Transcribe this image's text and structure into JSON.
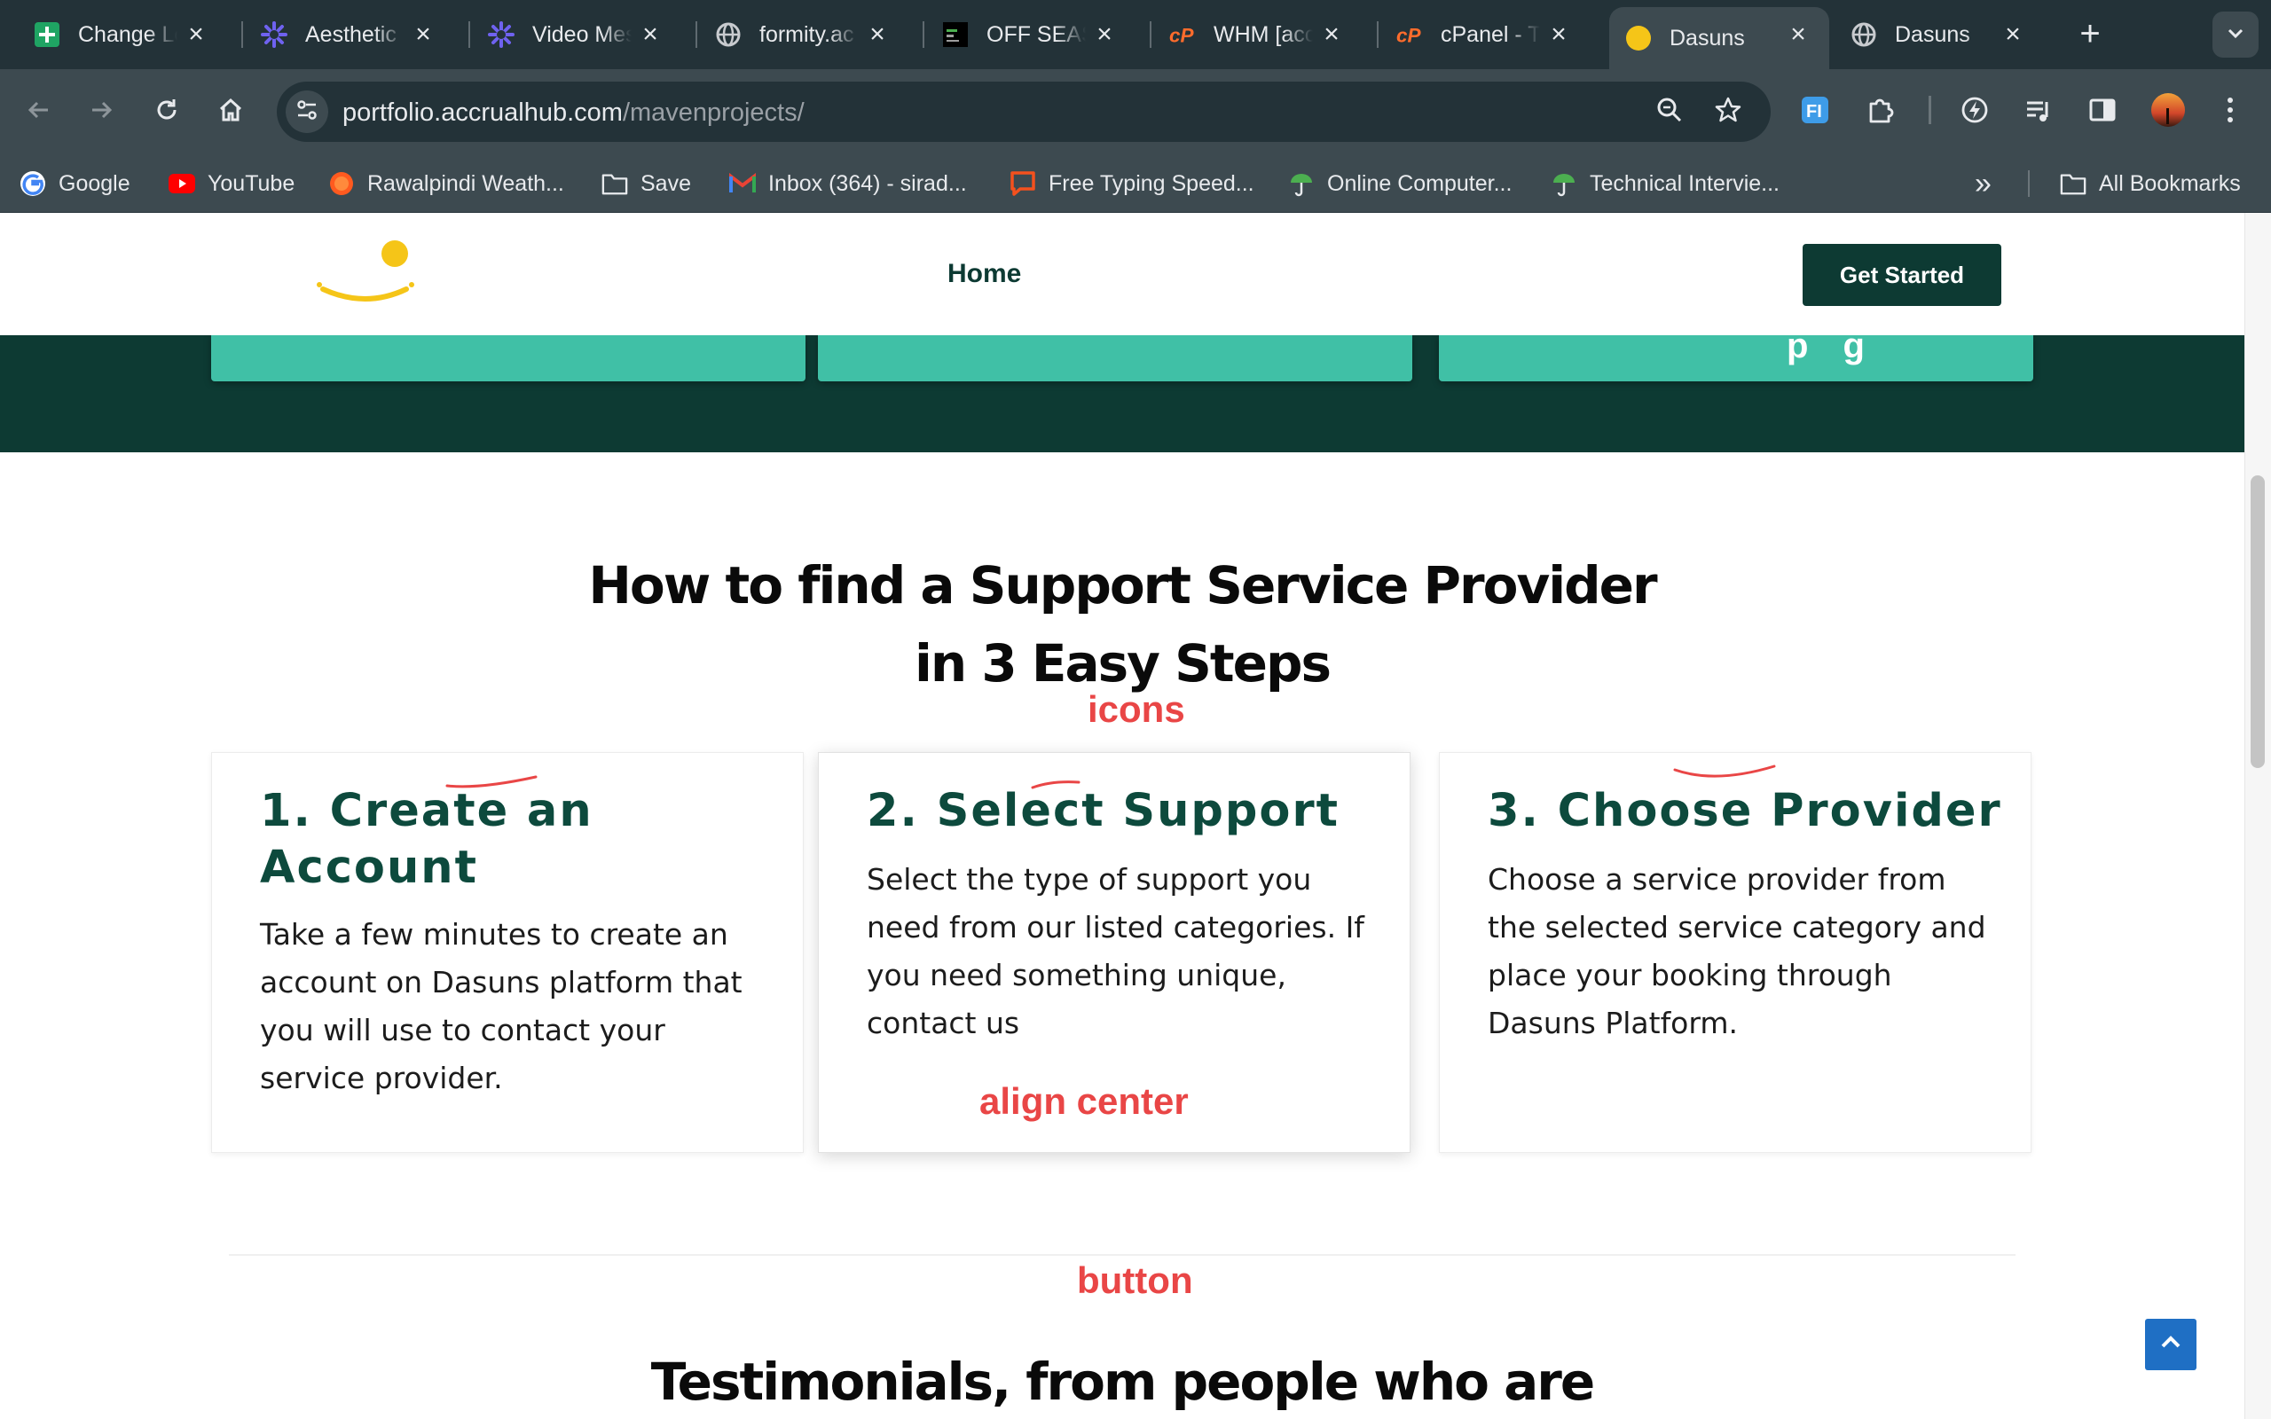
{
  "browser": {
    "tabs": [
      {
        "title": "Change Lo",
        "icon": "sheets-icon"
      },
      {
        "title": "Aesthetic",
        "icon": "gear-flower-icon"
      },
      {
        "title": "Video Mes",
        "icon": "gear-flower-icon"
      },
      {
        "title": "formity.ac",
        "icon": "globe-icon"
      },
      {
        "title": "OFF SEAS",
        "icon": "terminal-icon"
      },
      {
        "title": "WHM [acc",
        "icon": "cpanel-icon"
      },
      {
        "title": "cPanel - T",
        "icon": "cpanel-icon"
      },
      {
        "title": "Dasuns",
        "icon": "dasuns-favicon",
        "active": true
      },
      {
        "title": "Dasuns",
        "icon": "globe-icon"
      }
    ],
    "new_tab_label": "+",
    "url_host": "portfolio.accrualhub.com",
    "url_path": "/mavenprojects/",
    "bookmarks": [
      {
        "label": "Google",
        "icon": "google-icon"
      },
      {
        "label": "YouTube",
        "icon": "youtube-icon"
      },
      {
        "label": "Rawalpindi Weath...",
        "icon": "weather-icon"
      },
      {
        "label": "Save",
        "icon": "folder-icon"
      },
      {
        "label": "Inbox (364) - sirad...",
        "icon": "gmail-icon"
      },
      {
        "label": "Free Typing Speed...",
        "icon": "chat-bubble-icon"
      },
      {
        "label": "Online Computer...",
        "icon": "umbrella-icon"
      },
      {
        "label": "Technical Intervie...",
        "icon": "umbrella-icon"
      }
    ],
    "bookmarks_overflow": "»",
    "all_bookmarks": "All Bookmarks"
  },
  "site": {
    "nav_home": "Home",
    "cta_label": "Get Started",
    "teal_card_partial_text": "p   g"
  },
  "section": {
    "title_line1": "How to find a Support Service Provider",
    "title_line2": "in 3 Easy Steps",
    "steps": [
      {
        "title": "1. Create an Account",
        "body": "Take a few minutes to create an account on Dasuns platform that you will use to contact your service provider."
      },
      {
        "title": "2. Select Support",
        "body": "Select the type of support you need from our listed categories. If you need something unique, contact us"
      },
      {
        "title": "3. Choose Provider",
        "body": "Choose a service provider from the selected service category and place your booking through Dasuns Platform."
      }
    ]
  },
  "annotations": {
    "icons": "icons",
    "align_center": "align center",
    "button": "button"
  },
  "testimonials_title": "Testimonials, from people who are",
  "colors": {
    "brand_dark": "#0d3a33",
    "brand_teal": "#40c0a6",
    "step_title": "#0d4a3d",
    "annotation_red": "#e94646",
    "back_to_top_blue": "#1f6fc4",
    "logo_yellow": "#f5c518"
  }
}
